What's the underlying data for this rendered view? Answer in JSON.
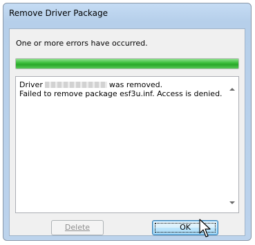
{
  "window": {
    "title": "Remove Driver Package"
  },
  "dialog": {
    "message": "One or more errors have occurred.",
    "progress_fraction": 1.0,
    "log": {
      "line1_prefix": "Driver",
      "line1_suffix": "was removed.",
      "line2": "Failed to remove package esf3u.inf. Access is denied."
    },
    "buttons": {
      "delete_label": "Delete",
      "ok_label": "OK"
    }
  },
  "colors": {
    "progress": "#2aa82a",
    "title_bar": "#c5dcf4"
  }
}
